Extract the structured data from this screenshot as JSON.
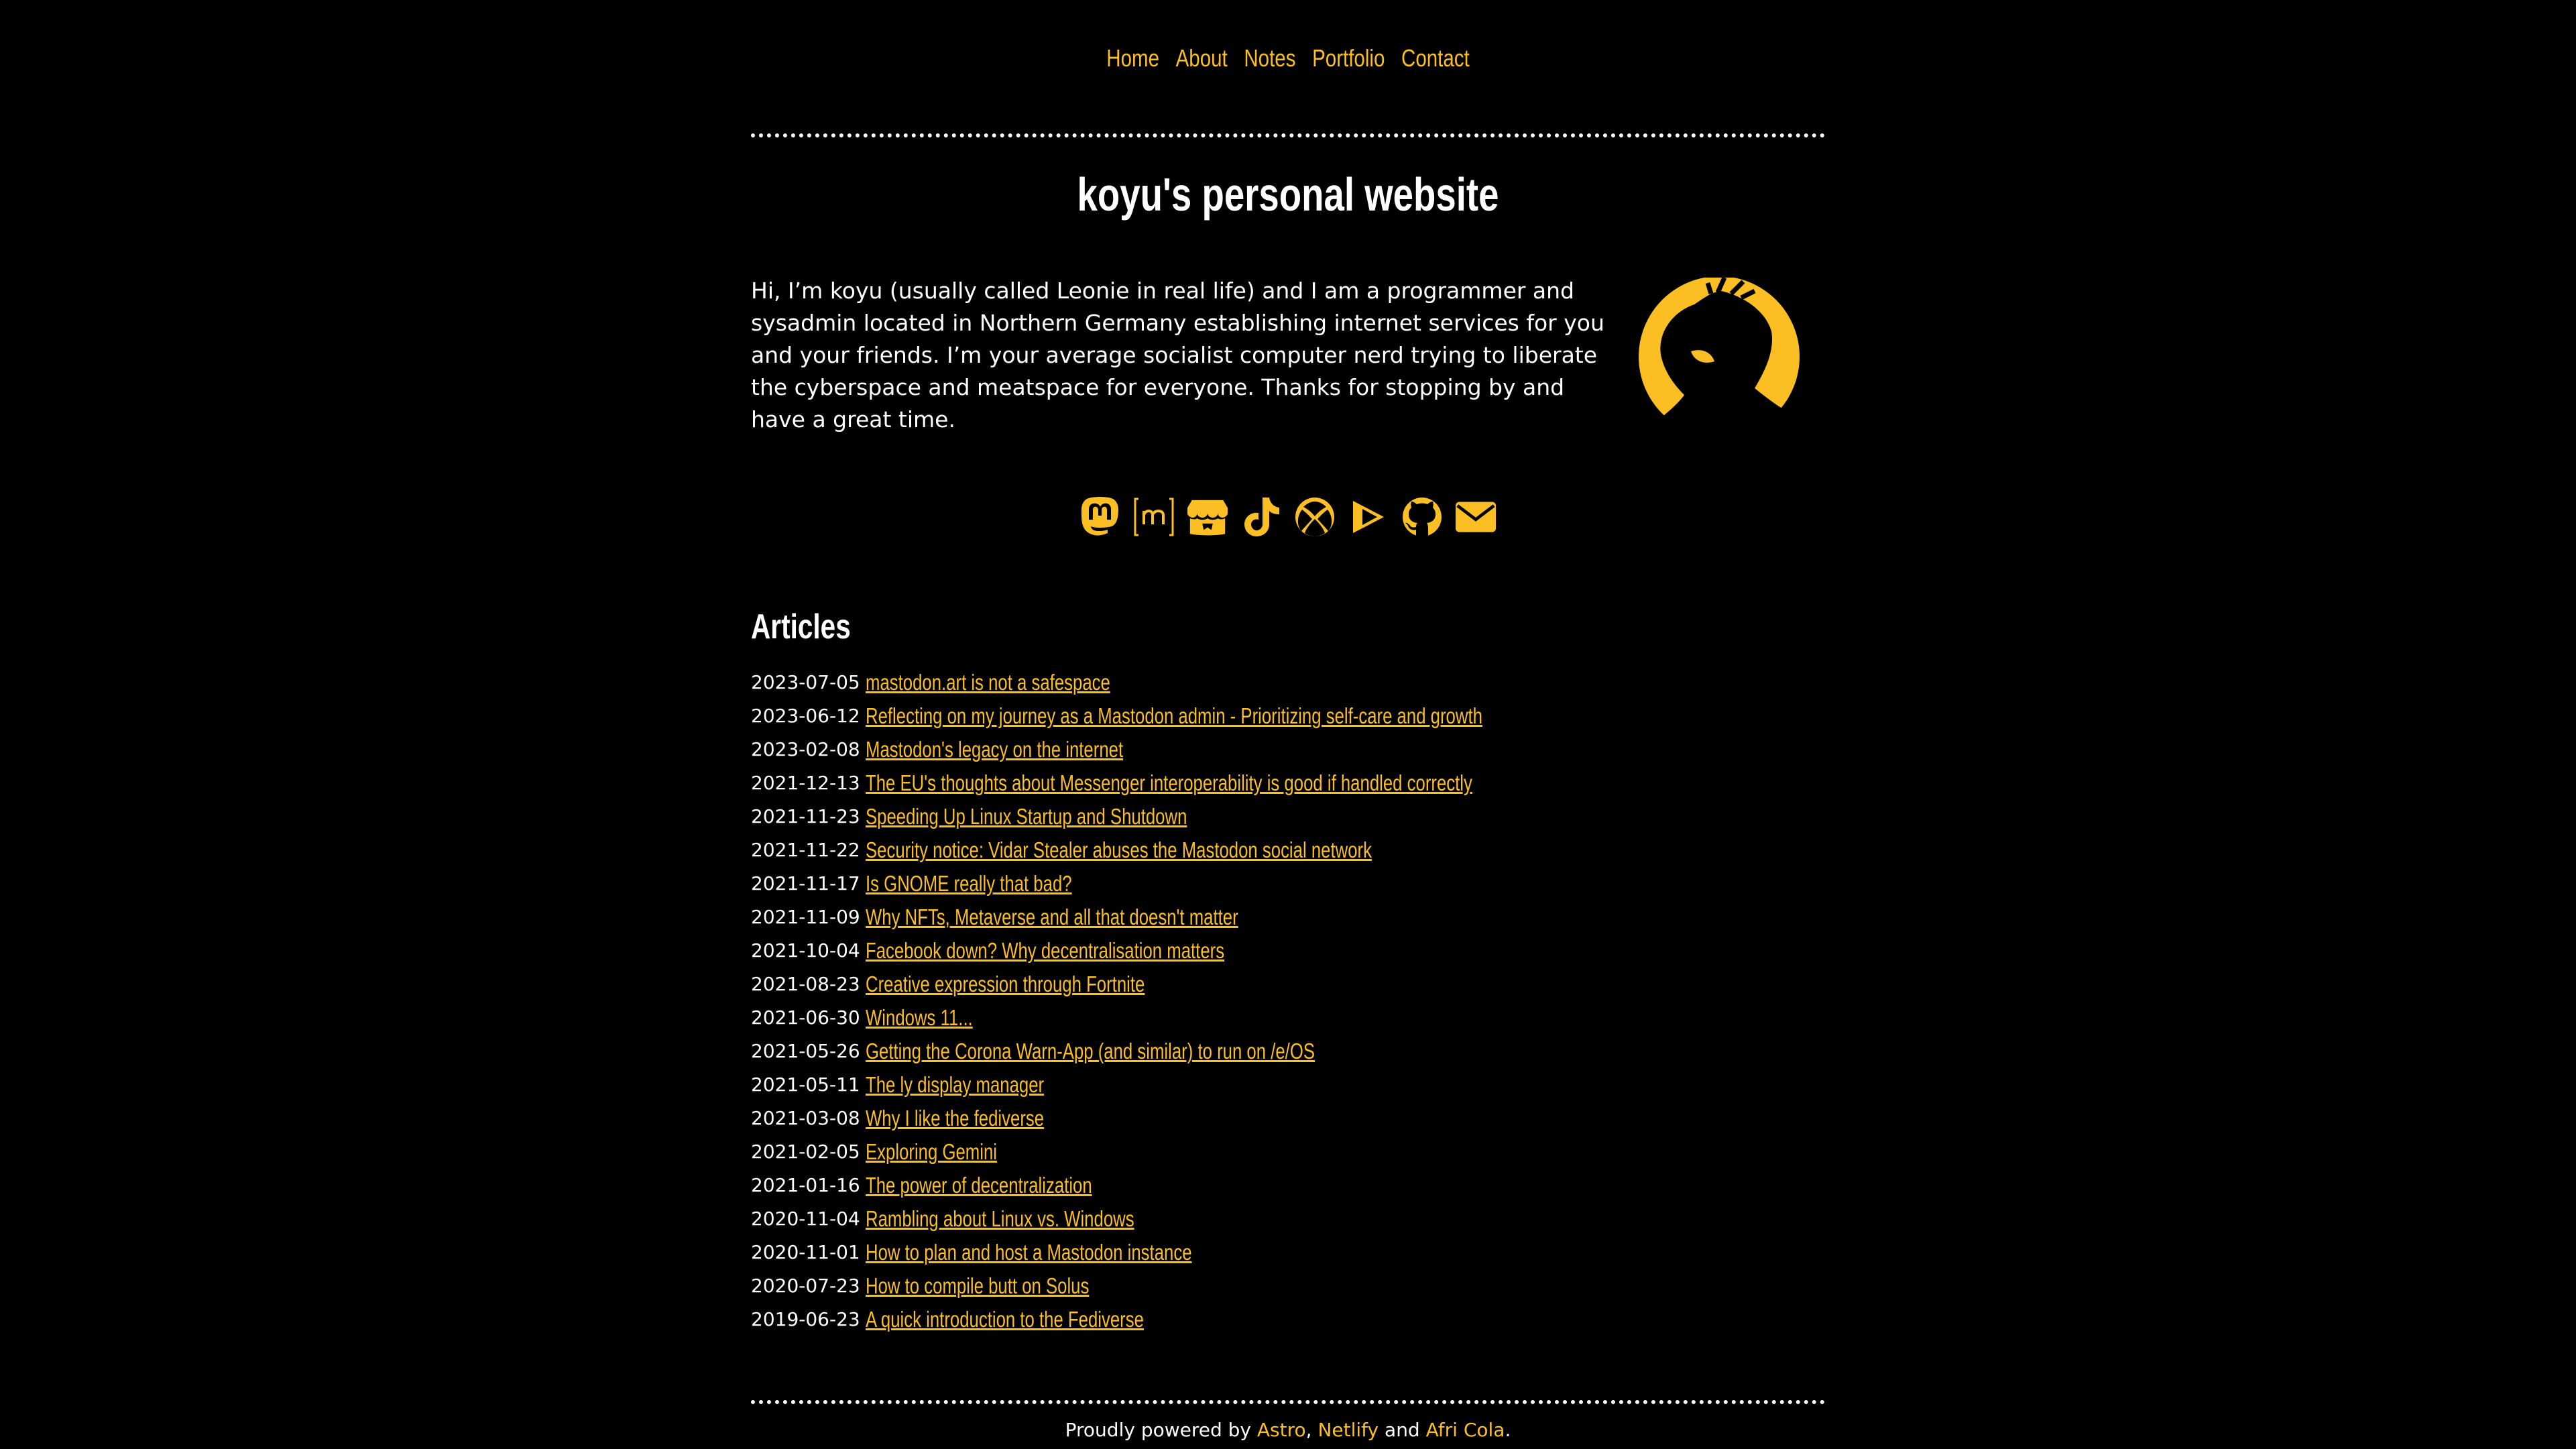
{
  "nav": {
    "items": [
      {
        "label": "Home"
      },
      {
        "label": "About"
      },
      {
        "label": "Notes"
      },
      {
        "label": "Portfolio"
      },
      {
        "label": "Contact"
      }
    ]
  },
  "header": {
    "title": "koyu's personal website"
  },
  "intro": {
    "text": "Hi, I’m koyu (usually called Leonie in real life) and I am a programmer and sysadmin located in Northern Germany establishing internet services for you and your friends. I’m your average socialist computer nerd trying to liberate the cyberspace and meatspace for everyone. Thanks for stopping by and have a great time."
  },
  "social": {
    "icons": [
      "mastodon-icon",
      "matrix-icon",
      "itch-io-icon",
      "tiktok-icon",
      "xbox-icon",
      "play-games-icon",
      "github-icon",
      "email-icon"
    ]
  },
  "articles": {
    "heading": "Articles",
    "items": [
      {
        "date": "2023-07-05",
        "title": "mastodon.art is not a safespace"
      },
      {
        "date": "2023-06-12",
        "title": "Reflecting on my journey as a Mastodon admin - Prioritizing self-care and growth"
      },
      {
        "date": "2023-02-08",
        "title": "Mastodon's legacy on the internet"
      },
      {
        "date": "2021-12-13",
        "title": "The EU's thoughts about Messenger interoperability is good if handled correctly"
      },
      {
        "date": "2021-11-23",
        "title": "Speeding Up Linux Startup and Shutdown"
      },
      {
        "date": "2021-11-22",
        "title": "Security notice: Vidar Stealer abuses the Mastodon social network"
      },
      {
        "date": "2021-11-17",
        "title": "Is GNOME really that bad?"
      },
      {
        "date": "2021-11-09",
        "title": "Why NFTs, Metaverse and all that doesn't matter"
      },
      {
        "date": "2021-10-04",
        "title": "Facebook down? Why decentralisation matters"
      },
      {
        "date": "2021-08-23",
        "title": "Creative expression through Fortnite"
      },
      {
        "date": "2021-06-30",
        "title": "Windows 11..."
      },
      {
        "date": "2021-05-26",
        "title": "Getting the Corona Warn-App (and similar) to run on /e/OS"
      },
      {
        "date": "2021-05-11",
        "title": "The ly display manager"
      },
      {
        "date": "2021-03-08",
        "title": "Why I like the fediverse"
      },
      {
        "date": "2021-02-05",
        "title": "Exploring Gemini"
      },
      {
        "date": "2021-01-16",
        "title": "The power of decentralization"
      },
      {
        "date": "2020-11-04",
        "title": "Rambling about Linux vs. Windows"
      },
      {
        "date": "2020-11-01",
        "title": "How to plan and host a Mastodon instance"
      },
      {
        "date": "2020-07-23",
        "title": "How to compile butt on Solus"
      },
      {
        "date": "2019-06-23",
        "title": "A quick introduction to the Fediverse"
      }
    ]
  },
  "footer": {
    "prefix": "Proudly powered by",
    "link1": "Astro",
    "sep": ",",
    "link2": "Netlify",
    "and": "and",
    "link3": "Afri Cola",
    "suffix": "."
  },
  "colors": {
    "background": "#000000",
    "text": "#ffffff",
    "accent": "#fbbf24"
  }
}
